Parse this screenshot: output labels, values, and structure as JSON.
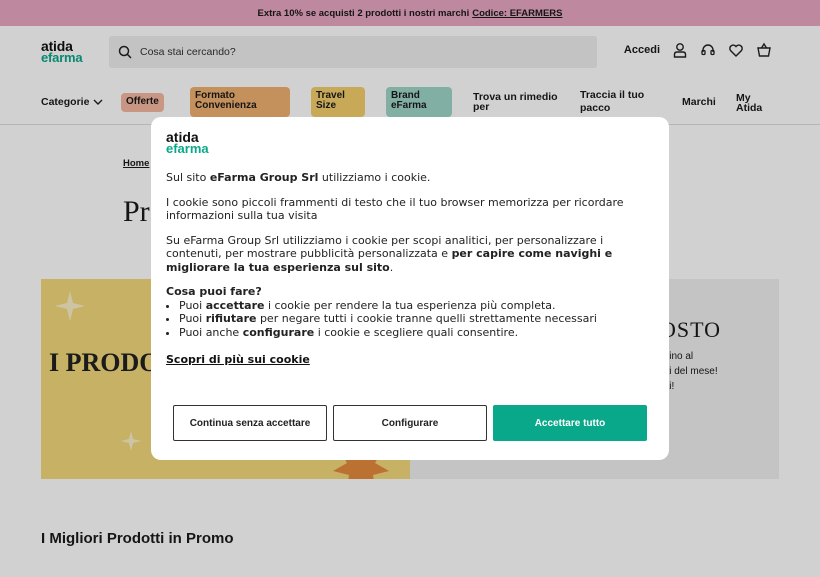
{
  "promo": {
    "text": "Extra 10% se acquisti 2 prodotti i nostri marchi",
    "code": "Codice: EFARMERS"
  },
  "header": {
    "logo_line1": "atida",
    "logo_line2": "efarma",
    "search_placeholder": "Cosa stai cercando?",
    "login_label": "Accedi"
  },
  "nav": {
    "categorie": "Categorie",
    "offerte": "Offerte",
    "formato": "Formato Convenienza",
    "travel": "Travel Size",
    "brand": "Brand eFarma",
    "rimedio": "Trova un rimedio per",
    "traccia": "Traccia il tuo pacco",
    "marchi": "Marchi",
    "myatida": "My Atida"
  },
  "colors": {
    "accent": "#0aa88a",
    "promo_bar": "#e8a7c2",
    "offerte_pill": "#f4b8a0",
    "formato_pill": "#f0b070",
    "travel_pill": "#f3cf6c",
    "brand_pill": "#9fd6c8"
  },
  "page": {
    "breadcrumb": "Home",
    "title": "Pr",
    "banner_left_text": "I PRODO DEL MES",
    "banner_right_title": "OSTO",
    "banner_right_sub": "ati. Fino al\nodotti del mese!\neferiti!",
    "section_title": "I Migliori Prodotti in Promo"
  },
  "cookie": {
    "logo_line1": "atida",
    "logo_line2": "efarma",
    "p1_a": "Sul sito ",
    "p1_b": "eFarma Group Srl",
    "p1_c": " utilizziamo i cookie.",
    "p2": "I cookie sono piccoli frammenti di testo che il tuo browser memorizza per ricordare informazioni sulla tua visita",
    "p3_a": "Su eFarma Group Srl utilizziamo i cookie per scopi analitici, per personalizzare i contenuti, per mostrare pubblicità personalizzata e ",
    "p3_b": "per capire come navighi e migliorare la tua esperienza sul sito",
    "p3_c": ".",
    "heading": "Cosa puoi fare?",
    "b1_a": "Puoi ",
    "b1_b": "accettare",
    "b1_c": " i cookie per rendere la tua esperienza più completa.",
    "b2_a": "Puoi ",
    "b2_b": "rifiutare",
    "b2_c": " per negare tutti i cookie tranne quelli strettamente necessari",
    "b3_a": "Puoi anche ",
    "b3_b": "configurare",
    "b3_c": " i cookie e scegliere quali consentire.",
    "more_link": "Scopri di più sui cookie",
    "btn_continue": "Continua senza accettare",
    "btn_configure": "Configurare",
    "btn_accept": "Accettare tutto"
  }
}
